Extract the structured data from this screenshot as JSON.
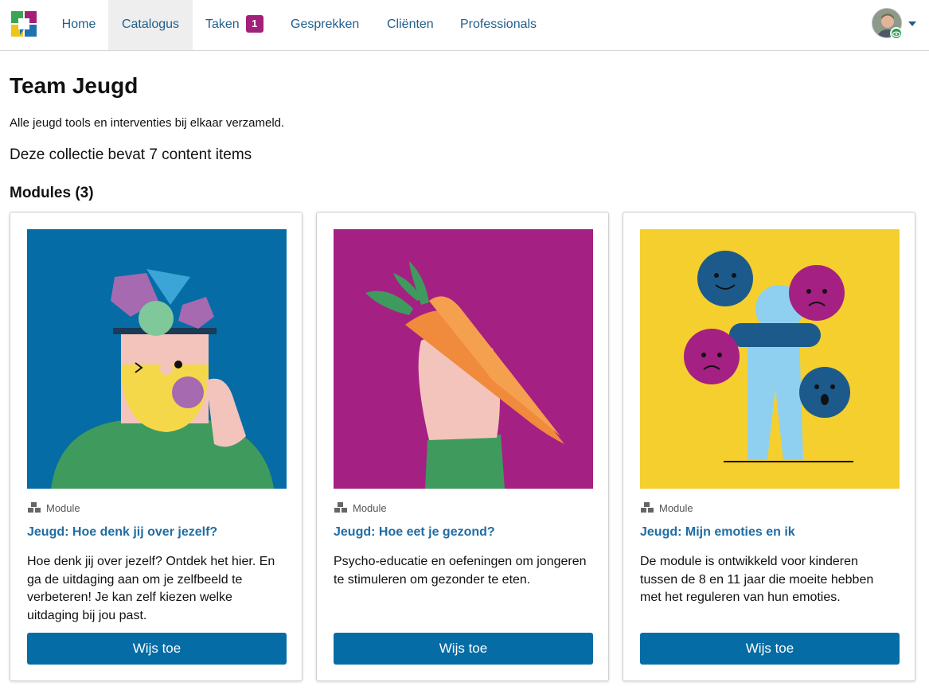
{
  "nav": {
    "items": [
      {
        "label": "Home"
      },
      {
        "label": "Catalogus"
      },
      {
        "label": "Taken",
        "badge": "1"
      },
      {
        "label": "Gesprekken"
      },
      {
        "label": "Cliënten"
      },
      {
        "label": "Professionals"
      }
    ],
    "active": "Catalogus",
    "badge_color": "#a3207a",
    "link_color": "#1f5f8b"
  },
  "page": {
    "title": "Team Jeugd",
    "description": "Alle jeugd tools en interventies bij elkaar verzameld.",
    "count_text": "Deze collectie bevat 7 content items",
    "section_title": "Modules (3)"
  },
  "cards": [
    {
      "type": "Module",
      "title": "Jeugd: Hoe denk jij over jezelf?",
      "description": "Hoe denk jij over jezelf? Ontdek het hier. En ga de uitdaging aan om je zelfbeeld te verbeteren! Je kan zelf kiezen welke uitdaging bij jou past.",
      "button": "Wijs toe",
      "image_bg": "#056ca5"
    },
    {
      "type": "Module",
      "title": "Jeugd: Hoe eet je gezond?",
      "description": "Psycho-educatie en oefeningen om jongeren te stimuleren om gezonder te eten.",
      "button": "Wijs toe",
      "image_bg": "#a52083"
    },
    {
      "type": "Module",
      "title": "Jeugd: Mijn emoties en ik",
      "description": "De module is ontwikkeld voor kinderen tussen de 8 en 11 jaar die moeite hebben met het reguleren van hun emoties.",
      "button": "Wijs toe",
      "image_bg": "#f5cf2e"
    }
  ],
  "colors": {
    "button": "#056ca5",
    "card_title": "#1f6da3"
  }
}
